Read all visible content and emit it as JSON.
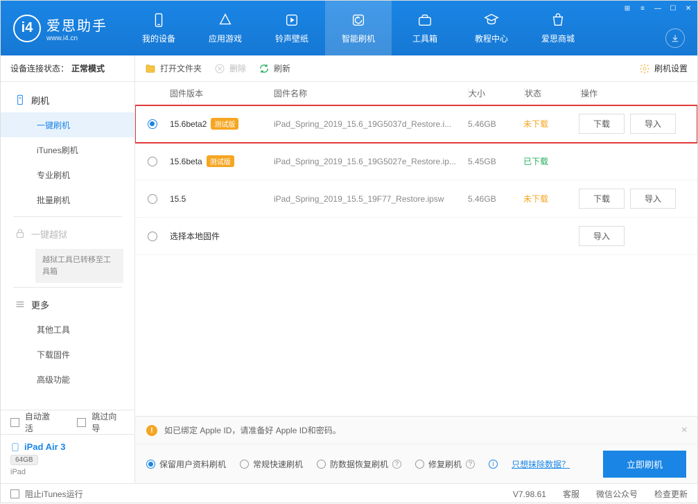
{
  "app": {
    "title": "爱思助手",
    "url": "www.i4.cn"
  },
  "nav": {
    "items": [
      {
        "label": "我的设备",
        "icon": "device"
      },
      {
        "label": "应用游戏",
        "icon": "apps"
      },
      {
        "label": "铃声壁纸",
        "icon": "ringtone"
      },
      {
        "label": "智能刷机",
        "icon": "flash",
        "active": true
      },
      {
        "label": "工具箱",
        "icon": "toolbox"
      },
      {
        "label": "教程中心",
        "icon": "tutorial"
      },
      {
        "label": "爱思商城",
        "icon": "store"
      }
    ]
  },
  "sidebar": {
    "conn_label": "设备连接状态：",
    "conn_value": "正常模式",
    "flash_header": "刷机",
    "items": [
      "一键刷机",
      "iTunes刷机",
      "专业刷机",
      "批量刷机"
    ],
    "jailbreak_header": "一键越狱",
    "jailbreak_note": "越狱工具已转移至工具箱",
    "more_header": "更多",
    "more_items": [
      "其他工具",
      "下载固件",
      "高级功能"
    ],
    "auto_activate": "自动激活",
    "skip_guide": "跳过向导",
    "device": {
      "name": "iPad Air 3",
      "capacity": "64GB",
      "type": "iPad"
    }
  },
  "toolbar": {
    "open_folder": "打开文件夹",
    "delete": "删除",
    "refresh": "刷新",
    "settings": "刷机设置"
  },
  "table": {
    "headers": {
      "version": "固件版本",
      "file": "固件名称",
      "size": "大小",
      "status": "状态",
      "ops": "操作"
    },
    "rows": [
      {
        "version": "15.6beta2",
        "beta": "测试版",
        "file": "iPad_Spring_2019_15.6_19G5037d_Restore.i...",
        "size": "5.46GB",
        "status": "未下载",
        "status_class": "orange",
        "selected": true,
        "ops": [
          "下载",
          "导入"
        ],
        "highlight": true
      },
      {
        "version": "15.6beta",
        "beta": "测试版",
        "file": "iPad_Spring_2019_15.6_19G5027e_Restore.ip...",
        "size": "5.45GB",
        "status": "已下载",
        "status_class": "green",
        "selected": false,
        "ops": []
      },
      {
        "version": "15.5",
        "beta": null,
        "file": "iPad_Spring_2019_15.5_19F77_Restore.ipsw",
        "size": "5.46GB",
        "status": "未下载",
        "status_class": "orange",
        "selected": false,
        "ops": [
          "下载",
          "导入"
        ]
      },
      {
        "version": "选择本地固件",
        "beta": null,
        "file": "",
        "size": "",
        "status": "",
        "status_class": "",
        "selected": false,
        "ops": [
          "导入"
        ],
        "local": true
      }
    ]
  },
  "bottom": {
    "warning": "如已绑定 Apple ID，请准备好 Apple ID和密码。",
    "options": [
      {
        "label": "保留用户资料刷机",
        "checked": true,
        "help": false
      },
      {
        "label": "常规快速刷机",
        "checked": false,
        "help": false
      },
      {
        "label": "防数据恢复刷机",
        "checked": false,
        "help": true
      },
      {
        "label": "修复刷机",
        "checked": false,
        "help": true
      }
    ],
    "erase_link": "只想抹除数据？",
    "flash_now": "立即刷机"
  },
  "footer": {
    "block_itunes": "阻止iTunes运行",
    "version": "V7.98.61",
    "support": "客服",
    "wechat": "微信公众号",
    "check_update": "检查更新"
  }
}
